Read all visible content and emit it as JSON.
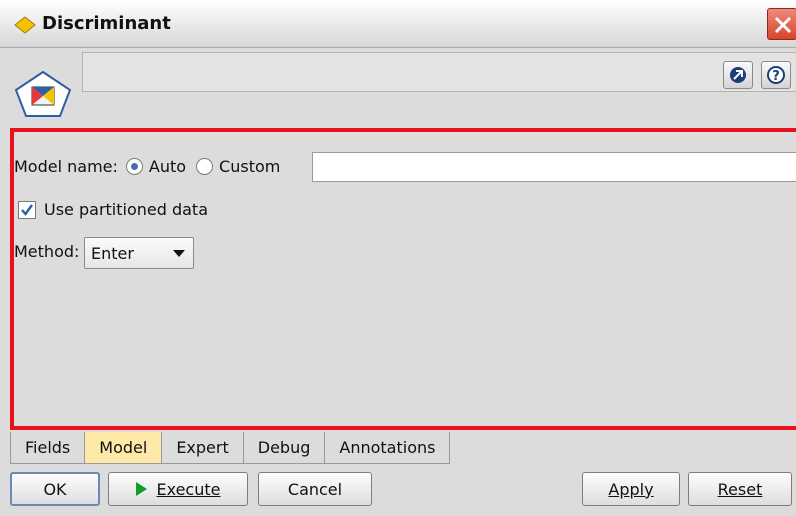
{
  "window": {
    "title": "Discriminant",
    "close_icon": "close-icon"
  },
  "header": {
    "node_icon": "discriminant-node-icon",
    "buttons": [
      "preview-icon",
      "help-icon"
    ]
  },
  "model": {
    "model_name_label": "Model name:",
    "radio_auto": "Auto",
    "radio_custom": "Custom",
    "selected_name_mode": "Auto",
    "custom_name_value": "",
    "use_partitioned_label": "Use partitioned data",
    "use_partitioned_checked": true,
    "method_label": "Method:",
    "method_value": "Enter"
  },
  "tabs": [
    {
      "label": "Fields"
    },
    {
      "label": "Model",
      "active": true
    },
    {
      "label": "Expert"
    },
    {
      "label": "Debug"
    },
    {
      "label": "Annotations"
    }
  ],
  "buttons": {
    "ok": "OK",
    "execute": "Execute",
    "cancel": "Cancel",
    "apply": "Apply",
    "reset": "Reset"
  },
  "colors": {
    "highlight_border": "#e8101a",
    "active_tab": "#ffe9a8",
    "execute_play": "#0f9e26"
  }
}
